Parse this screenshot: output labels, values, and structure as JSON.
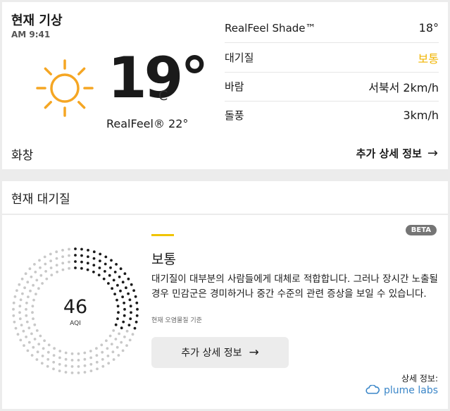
{
  "current": {
    "title": "현재 기상",
    "time": "AM 9:41",
    "temperature": "19°",
    "unit": "C",
    "realfeel": "RealFeel® 22°",
    "condition": "화창",
    "more_label": "추가 상세 정보",
    "weather_icon": "sun-icon",
    "sun_color": "#f5a623",
    "metrics": [
      {
        "label": "RealFeel Shade™",
        "value": "18°"
      },
      {
        "label": "대기질",
        "value": "보통"
      },
      {
        "label": "바람",
        "value": "서북서 2km/h"
      },
      {
        "label": "돌풍",
        "value": "3km/h"
      }
    ]
  },
  "air_quality": {
    "title": "현재 대기질",
    "beta": "BETA",
    "aqi": 46,
    "aqi_label": "AQI",
    "state": "보통",
    "state_color": "#f0c400",
    "description": "대기질이 대부분의 사람들에게 대체로 적합합니다. 그러나 장시간 노출될 경우 민감군은 경미하거나 중간 수준의 관련 증상을 보일 수 있습니다.",
    "source": "현재 오염물질 기준",
    "more_label": "추가 상세 정보",
    "detail_label": "상세 정보:",
    "provider": "plume labs"
  }
}
